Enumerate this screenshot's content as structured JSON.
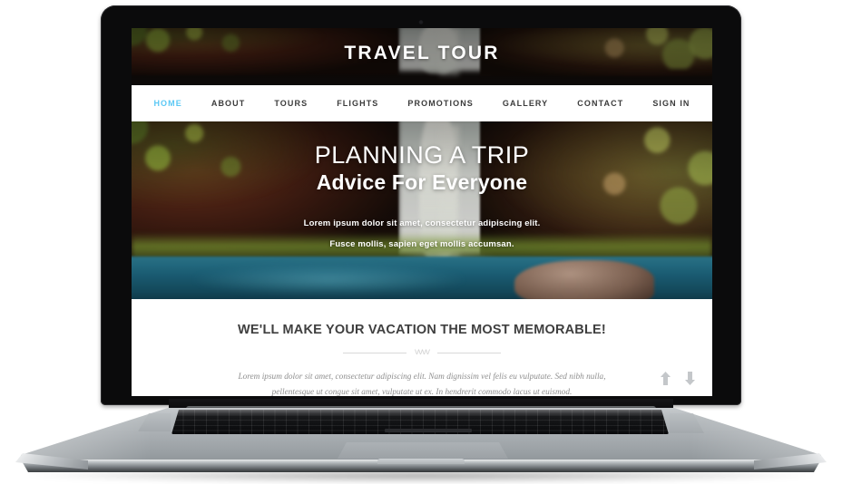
{
  "device": {
    "type": "laptop-mockup",
    "name": "MacBook Pro laptop mockup"
  },
  "website": {
    "site_title": "TRAVEL TOUR",
    "nav": {
      "items": [
        {
          "label": "HOME",
          "active": true
        },
        {
          "label": "ABOUT",
          "active": false
        },
        {
          "label": "TOURS",
          "active": false
        },
        {
          "label": "FLIGHTS",
          "active": false
        },
        {
          "label": "PROMOTIONS",
          "active": false
        },
        {
          "label": "GALLERY",
          "active": false
        },
        {
          "label": "CONTACT",
          "active": false
        },
        {
          "label": "SIGN IN",
          "active": false
        }
      ],
      "active_color": "#5bc8f5",
      "inactive_color": "#3b3b3b"
    },
    "hero": {
      "heading": "PLANNING A TRIP",
      "subheading": "Advice For Everyone",
      "paragraph_line1": "Lorem ipsum dolor sit amet, consectetur adipiscing elit.",
      "paragraph_line2": "Fusce mollis, sapien eget mollis accumsan.",
      "background": "waterfall-forest-photo"
    },
    "content": {
      "heading": "WE'LL MAKE YOUR VACATION THE MOST MEMORABLE!",
      "divider_ornament": "vvvv",
      "paragraph": "Lorem ipsum dolor sit amet, consectetur adipiscing elit. Nam dignissim vel felis eu vulputate. Sed nibh nulla, pellentesque ut congue sit amet, vulputate ut ex. In hendrerit commodo lacus ut euismod.",
      "scroll_up_icon": "arrow-up-icon",
      "scroll_down_icon": "arrow-down-icon"
    }
  }
}
